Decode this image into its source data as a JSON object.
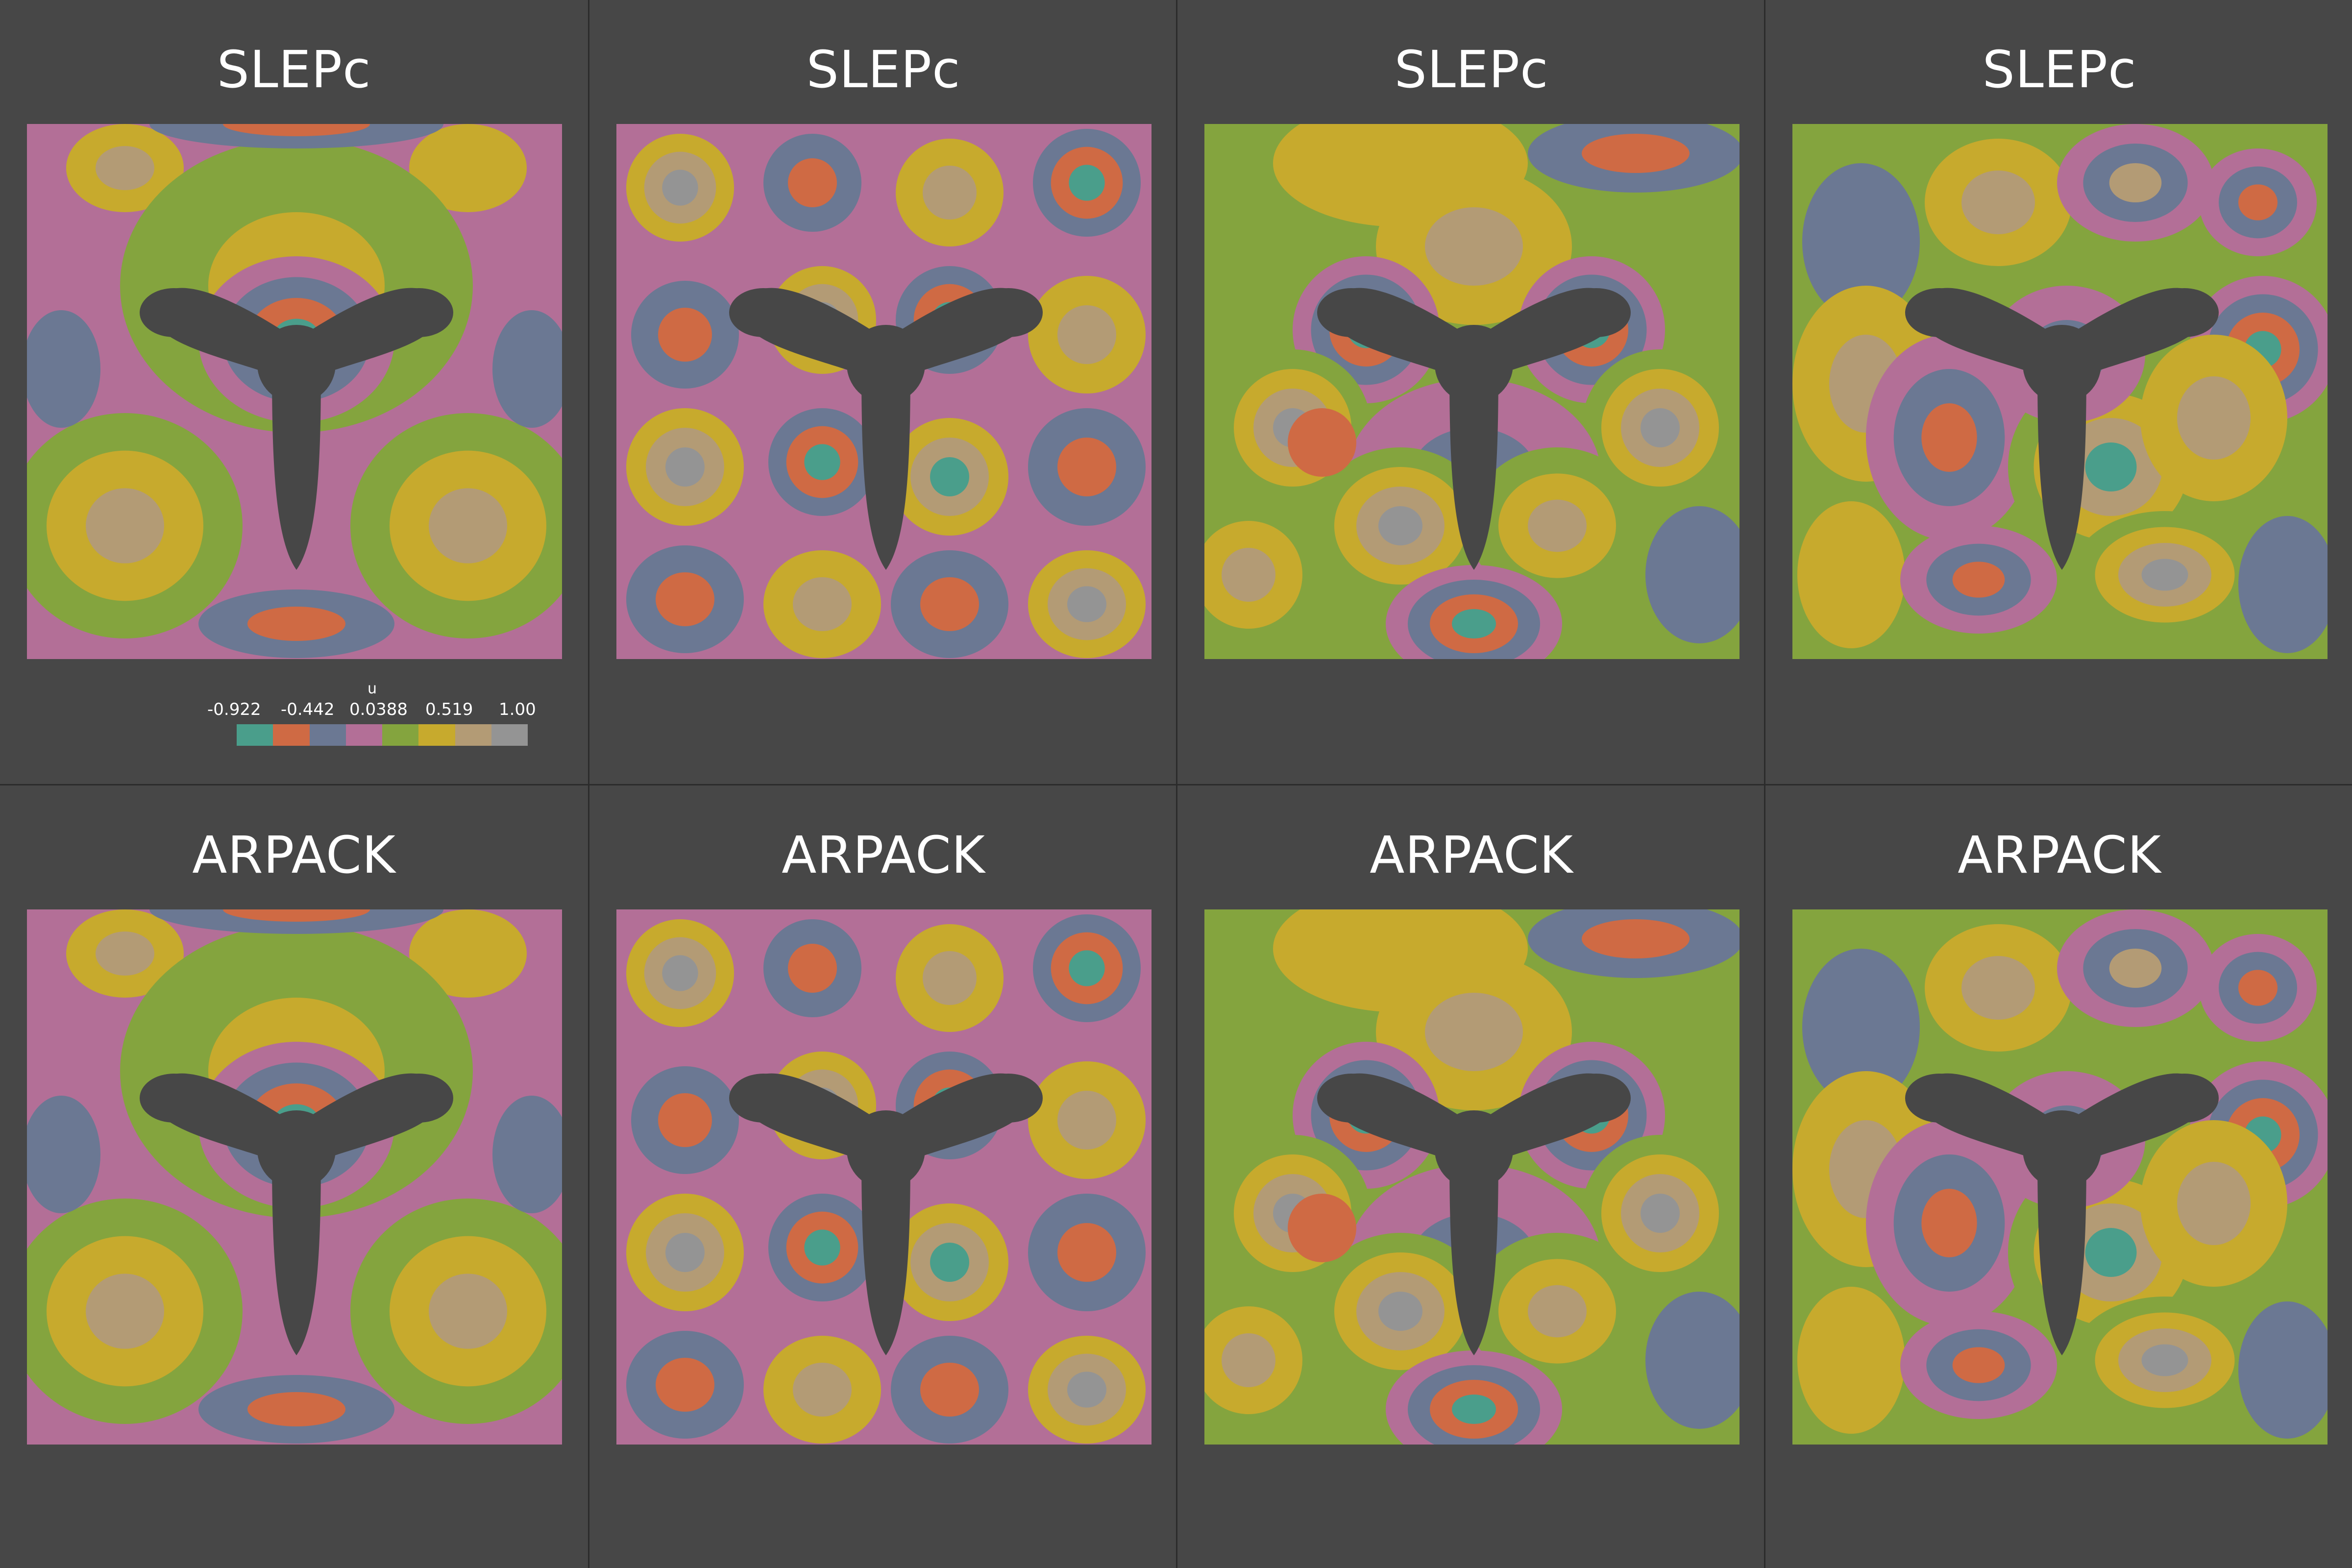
{
  "panels": [
    {
      "title": "SLEPc"
    },
    {
      "title": "SLEPc"
    },
    {
      "title": "SLEPc"
    },
    {
      "title": "SLEPc"
    },
    {
      "title": "ARPACK"
    },
    {
      "title": "ARPACK"
    },
    {
      "title": "ARPACK"
    },
    {
      "title": "ARPACK"
    }
  ],
  "colorbar": {
    "title": "u",
    "ticks": [
      "-0.922",
      "-0.442",
      "0.0388",
      "0.519",
      "1.00"
    ],
    "colors": [
      "#4a9e8b",
      "#cf6a44",
      "#6b7893",
      "#b36f97",
      "#84a43e",
      "#c7aa2d",
      "#b39b75",
      "#949494"
    ]
  },
  "colors": {
    "background": "#474747",
    "obstacle": "#474747"
  }
}
